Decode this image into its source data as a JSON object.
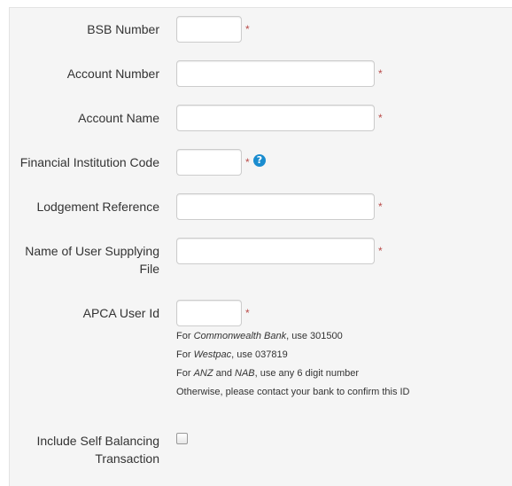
{
  "form": {
    "bsb": {
      "label": "BSB Number",
      "value": "",
      "required": "*"
    },
    "account_number": {
      "label": "Account Number",
      "value": "",
      "required": "*"
    },
    "account_name": {
      "label": "Account Name",
      "value": "",
      "required": "*"
    },
    "fi_code": {
      "label": "Financial Institution Code",
      "value": "",
      "required": "*",
      "help_icon": "question-circle-icon",
      "help_glyph": "?"
    },
    "lodgement_ref": {
      "label": "Lodgement Reference",
      "value": "",
      "required": "*"
    },
    "user_supplying": {
      "label_line1": "Name of User Supplying",
      "label_line2": "File",
      "value": "",
      "required": "*"
    },
    "apca": {
      "label": "APCA User Id",
      "value": "",
      "required": "*",
      "notes": {
        "line1_prefix": "For ",
        "line1_bank": "Commonwealth Bank",
        "line1_suffix": ", use 301500",
        "line2_prefix": "For ",
        "line2_bank": "Westpac",
        "line2_suffix": ", use 037819",
        "line3_prefix": "For ",
        "line3_bank1": "ANZ",
        "line3_mid": " and ",
        "line3_bank2": "NAB",
        "line3_suffix": ", use any 6 digit number",
        "line4": "Otherwise, please contact your bank to confirm this ID"
      }
    },
    "self_balancing": {
      "label_line1": "Include Self Balancing",
      "label_line2": "Transaction",
      "checked": false
    }
  },
  "colors": {
    "required": "#b94a48",
    "help": "#1a8ccf",
    "panel_bg": "#f5f5f5"
  }
}
